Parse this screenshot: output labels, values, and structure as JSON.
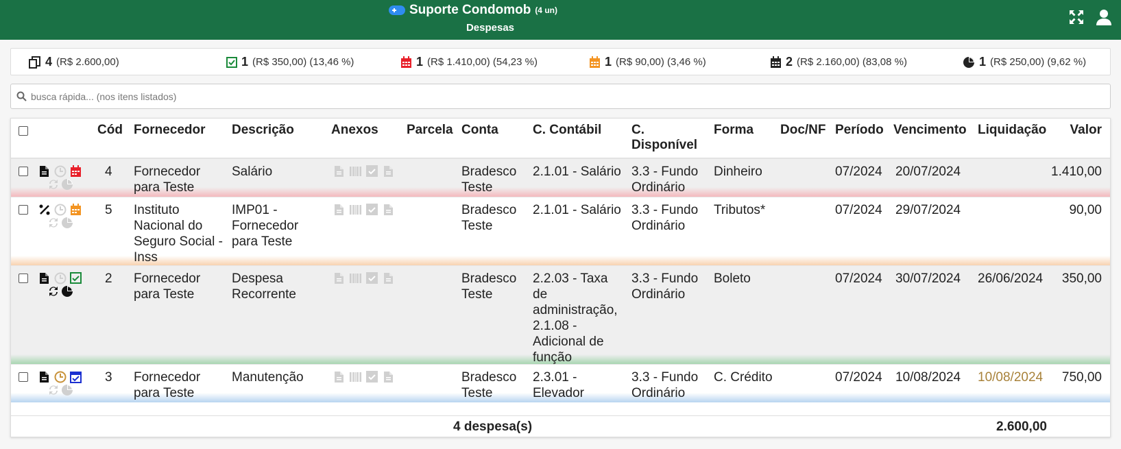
{
  "header": {
    "title": "Suporte Condomob",
    "units": "(4 un)",
    "subtitle": "Despesas",
    "icons": [
      "gamepad-icon",
      "expand-icon",
      "user-icon"
    ]
  },
  "summary": {
    "total": {
      "count": "4",
      "detail": "(R$ 2.600,00)"
    },
    "paid": {
      "count": "1",
      "detail": "(R$ 350,00) (13,46 %)"
    },
    "overdue": {
      "count": "1",
      "detail": "(R$ 1.410,00) (54,23 %)"
    },
    "pending": {
      "count": "1",
      "detail": "(R$ 90,00) (3,46 %)"
    },
    "scheduled": {
      "count": "2",
      "detail": "(R$ 2.160,00) (83,08 %)"
    },
    "partial": {
      "count": "1",
      "detail": "(R$ 250,00) (9,62 %)"
    }
  },
  "search": {
    "placeholder": "busca rápida... (nos itens listados)"
  },
  "columns": {
    "cod": "Cód",
    "fornecedor": "Fornecedor",
    "descricao": "Descrição",
    "anexos": "Anexos",
    "parcela": "Parcela",
    "conta": "Conta",
    "contabil": "C. Contábil",
    "disponivel_1": "C.",
    "disponivel_2": "Disponível",
    "forma": "Forma",
    "docnf": "Doc/NF",
    "periodo": "Período",
    "vencimento": "Vencimento",
    "liquidacao": "Liquidação",
    "valor": "Valor"
  },
  "rows": [
    {
      "cod": "4",
      "fornecedor": [
        "Fornecedor",
        "para Teste"
      ],
      "descricao": [
        "Salário"
      ],
      "conta": [
        "Bradesco",
        "Teste"
      ],
      "contabil": [
        "2.1.01 - Salário"
      ],
      "disponivel": [
        "3.3 - Fundo",
        "Ordinário"
      ],
      "forma": "Dinheiro",
      "docnf": "",
      "periodo": "07/2024",
      "vencimento": "20/07/2024",
      "liquidacao": "",
      "valor": "1.410,00",
      "status_color": "#e8202a",
      "gradient": "#f4b9bd"
    },
    {
      "cod": "5",
      "fornecedor": [
        "Instituto",
        "Nacional do",
        "Seguro Social -",
        "Inss"
      ],
      "descricao": [
        "IMP01 -",
        "Fornecedor",
        "para Teste"
      ],
      "conta": [
        "Bradesco",
        "Teste"
      ],
      "contabil": [
        "2.1.01 - Salário"
      ],
      "disponivel": [
        "3.3 - Fundo",
        "Ordinário"
      ],
      "forma": "Tributos*",
      "docnf": "",
      "periodo": "07/2024",
      "vencimento": "29/07/2024",
      "liquidacao": "",
      "valor": "90,00",
      "status_color": "#f39422",
      "gradient": "#f8d2b0"
    },
    {
      "cod": "2",
      "fornecedor": [
        "Fornecedor",
        "para Teste"
      ],
      "descricao": [
        "Despesa",
        "Recorrente"
      ],
      "conta": [
        "Bradesco",
        "Teste"
      ],
      "contabil": [
        "2.2.03 - Taxa",
        "de",
        "administração,",
        "2.1.08 -",
        "Adicional de",
        "função"
      ],
      "disponivel": [
        "3.3 - Fundo",
        "Ordinário"
      ],
      "forma": "Boleto",
      "docnf": "",
      "periodo": "07/2024",
      "vencimento": "30/07/2024",
      "liquidacao": "26/06/2024",
      "valor": "350,00",
      "status_color": "#1a8a3a",
      "gradient": "#a9d6b2"
    },
    {
      "cod": "3",
      "fornecedor": [
        "Fornecedor",
        "para Teste"
      ],
      "descricao": [
        "Manutenção"
      ],
      "conta": [
        "Bradesco",
        "Teste"
      ],
      "contabil": [
        "2.3.01 -",
        "Elevador"
      ],
      "disponivel": [
        "3.3 - Fundo",
        "Ordinário"
      ],
      "forma": "C. Crédito",
      "docnf": "",
      "periodo": "07/2024",
      "vencimento": "10/08/2024",
      "liquidacao": "10/08/2024",
      "valor": "750,00",
      "status_color": "#1a2fd0",
      "gradient": "#b8d4f0"
    }
  ],
  "footer": {
    "count": "4 despesa(s)",
    "total": "2.600,00"
  },
  "colors": {
    "header_bg": "#1a7145",
    "liquidacao_future": "#a8823a"
  }
}
